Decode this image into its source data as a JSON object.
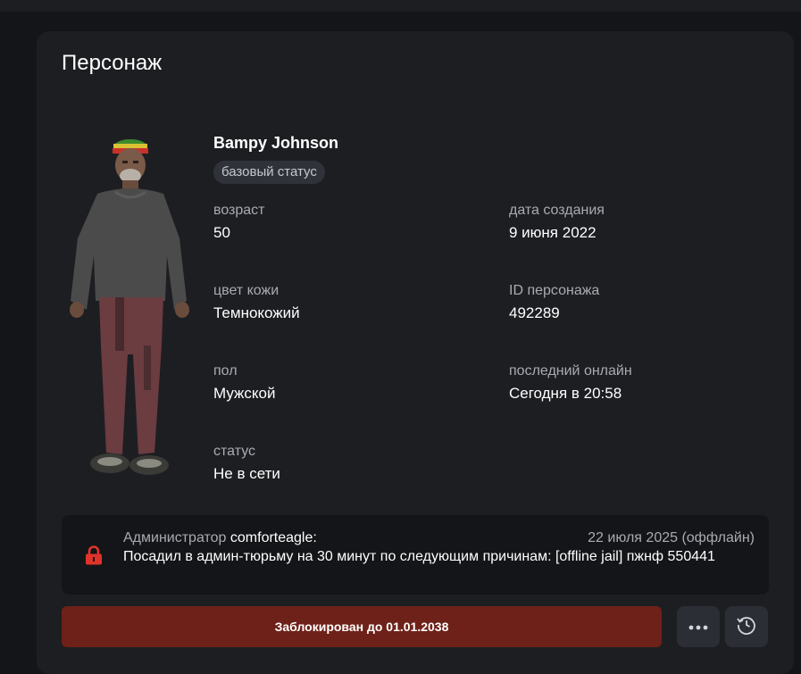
{
  "card": {
    "title": "Персонаж"
  },
  "character": {
    "name": "Bampy Johnson",
    "status_chip": "базовый статус",
    "fields": {
      "age": {
        "label": "возраст",
        "value": "50"
      },
      "created": {
        "label": "дата создания",
        "value": "9 июня 2022"
      },
      "skin": {
        "label": "цвет кожи",
        "value": "Темнокожий"
      },
      "id": {
        "label": "ID персонажа",
        "value": "492289"
      },
      "gender": {
        "label": "пол",
        "value": "Мужской"
      },
      "last_online": {
        "label": "последний онлайн",
        "value": "Сегодня в 20:58"
      },
      "status": {
        "label": "статус",
        "value": "Не в сети"
      }
    }
  },
  "notice": {
    "prefix": "Администратор ",
    "admin": "comforteagle:",
    "date": "22 июля 2025 (оффлайн)",
    "body": "Посадил в админ-тюрьму на 30 минут по следующим причинам: [offline jail] пжнф 550441",
    "icon": "lock-icon"
  },
  "actions": {
    "ban_label": "Заблокирован до 01.01.2038",
    "more_icon": "more-dots-icon",
    "history_icon": "history-clock-icon"
  },
  "colors": {
    "background": "#141518",
    "card": "#1d1e22",
    "ban": "#6e2118",
    "lock": "#e0332b"
  }
}
